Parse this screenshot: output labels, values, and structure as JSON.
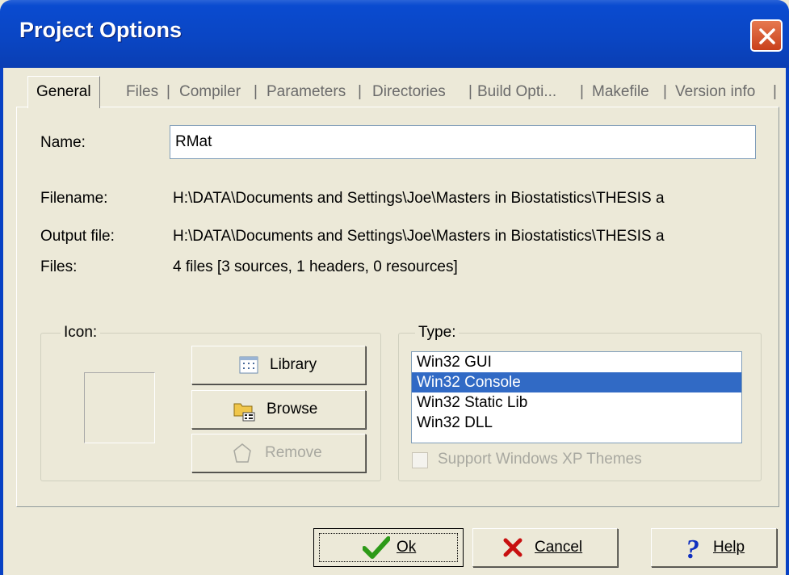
{
  "window": {
    "title": "Project Options"
  },
  "tabs": [
    {
      "label": "General",
      "active": true
    },
    {
      "label": "Files"
    },
    {
      "label": "Compiler"
    },
    {
      "label": "Parameters"
    },
    {
      "label": "Directories"
    },
    {
      "label": "Build Opti..."
    },
    {
      "label": "Makefile"
    },
    {
      "label": "Version info"
    }
  ],
  "general": {
    "name_label": "Name:",
    "name_value": "RMat",
    "filename_label": "Filename:",
    "filename_value": "H:\\DATA\\Documents and Settings\\Joe\\Masters in Biostatistics\\THESIS a",
    "output_label": "Output file:",
    "output_value": "H:\\DATA\\Documents and Settings\\Joe\\Masters in Biostatistics\\THESIS a",
    "files_label": "Files:",
    "files_value": "4 files [3 sources, 1 headers, 0 resources]"
  },
  "icon_group": {
    "legend": "Icon:",
    "library_label": "Library",
    "browse_label": "Browse",
    "remove_label": "Remove"
  },
  "type_group": {
    "legend": "Type:",
    "items": [
      "Win32 GUI",
      "Win32 Console",
      "Win32 Static Lib",
      "Win32 DLL"
    ],
    "selected": "Win32 Console",
    "xp_themes_label": "Support Windows XP Themes",
    "xp_themes_checked": false
  },
  "footer": {
    "ok_label": "Ok",
    "cancel_label": "Cancel",
    "help_label": "Help"
  },
  "colors": {
    "titlebar": "#0a46c4",
    "selection": "#316ac5",
    "dialog_bg": "#ece9d8",
    "ok_check": "#2d9a18",
    "cancel_x": "#c81010",
    "help_q": "#1030c0"
  }
}
